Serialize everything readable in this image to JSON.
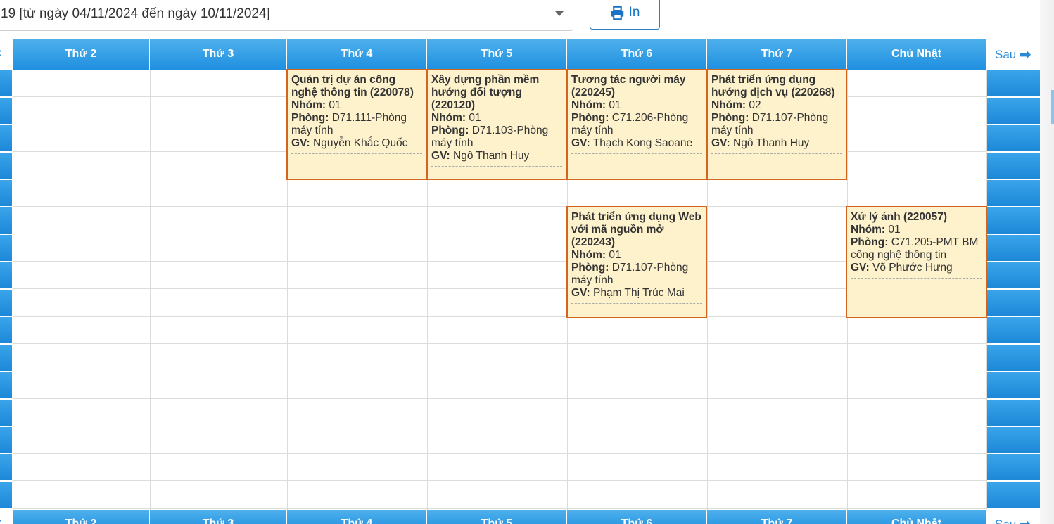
{
  "week_select": {
    "value": "19 [từ ngày 04/11/2024 đến ngày 10/11/2024]"
  },
  "print_button": {
    "label": "In"
  },
  "nav": {
    "prev_label": "c",
    "next_label": "Sau"
  },
  "days": [
    "Thứ 2",
    "Thứ 3",
    "Thứ 4",
    "Thứ 5",
    "Thứ 6",
    "Thứ 7",
    "Chủ Nhật"
  ],
  "labels": {
    "group": "Nhóm:",
    "room": "Phòng:",
    "teacher": "GV:"
  },
  "courses": [
    {
      "title": "Quản trị dự án công nghệ thông tin (220078)",
      "group": "01",
      "room": "D71.111-Phòng máy tính",
      "teacher": "Nguyễn Khắc Quốc"
    },
    {
      "title": "Xây dựng phần mềm hướng đối tượng (220120)",
      "group": "01",
      "room": "D71.103-Phòng máy tính",
      "teacher": "Ngô Thanh Huy"
    },
    {
      "title": "Tương tác người máy (220245)",
      "group": "01",
      "room": "C71.206-Phòng máy tính",
      "teacher": "Thạch Kong Saoane"
    },
    {
      "title": "Phát triển ứng dụng hướng dịch vụ (220268)",
      "group": "02",
      "room": "D71.107-Phòng máy tính",
      "teacher": "Ngô Thanh Huy"
    },
    {
      "title": "Phát triển ứng dụng Web với mã nguồn mở (220243)",
      "group": "01",
      "room": "D71.107-Phòng máy tính",
      "teacher": "Phạm Thị Trúc Mai"
    },
    {
      "title": "Xử lý ảnh (220057)",
      "group": "01",
      "room": "C71.205-PMT BM công nghệ thông tin",
      "teacher": "Võ Phước Hưng"
    }
  ]
}
